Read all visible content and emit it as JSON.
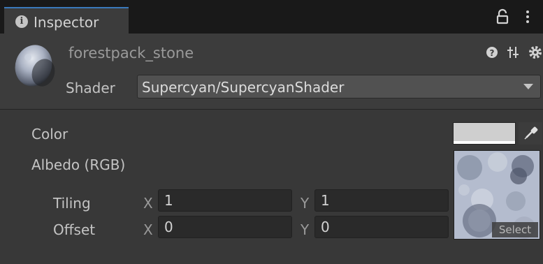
{
  "tab": {
    "icon": "info-icon",
    "label": "Inspector"
  },
  "header": {
    "asset_name": "forestpack_stone",
    "shader_label": "Shader",
    "shader_value": "Supercyan/SupercyanShader"
  },
  "properties": {
    "color_label": "Color",
    "color_value": "#cfcfcf",
    "albedo_label": "Albedo (RGB)",
    "select_label": "Select",
    "tiling_label": "Tiling",
    "offset_label": "Offset",
    "axis_x": "X",
    "axis_y": "Y",
    "tiling_x": "1",
    "tiling_y": "1",
    "offset_x": "0",
    "offset_y": "0"
  },
  "colors": {
    "accent": "#3a79bb",
    "panel": "#383838",
    "header": "#3c3c3c"
  }
}
